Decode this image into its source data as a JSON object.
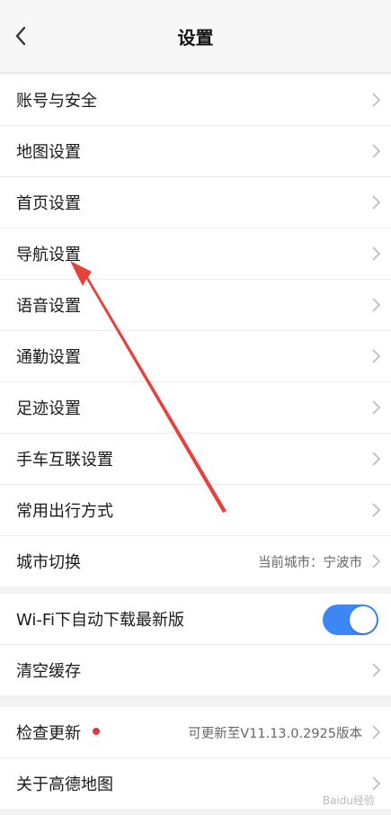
{
  "header": {
    "title": "设置",
    "back_icon": "chevron-left-icon"
  },
  "groups": {
    "main": [
      {
        "label": "账号与安全"
      },
      {
        "label": "地图设置"
      },
      {
        "label": "首页设置"
      },
      {
        "label": "导航设置"
      },
      {
        "label": "语音设置"
      },
      {
        "label": "通勤设置"
      },
      {
        "label": "足迹设置"
      },
      {
        "label": "手车互联设置"
      },
      {
        "label": "常用出行方式"
      },
      {
        "label": "城市切换",
        "value": "当前城市：宁波市"
      }
    ],
    "storage": {
      "wifi_download": {
        "label": "Wi-Fi下自动下载最新版",
        "enabled": true
      },
      "clear_cache": {
        "label": "清空缓存"
      }
    },
    "about": {
      "check_update": {
        "label": "检查更新",
        "value": "可更新至V11.13.0.2925版本",
        "badge_color": "#e4393c"
      },
      "about_app": {
        "label": "关于高德地图"
      }
    }
  },
  "colors": {
    "accent": "#3d86f5",
    "arrow": "#e8413c"
  },
  "watermark": {
    "text": "Baidu经验"
  }
}
